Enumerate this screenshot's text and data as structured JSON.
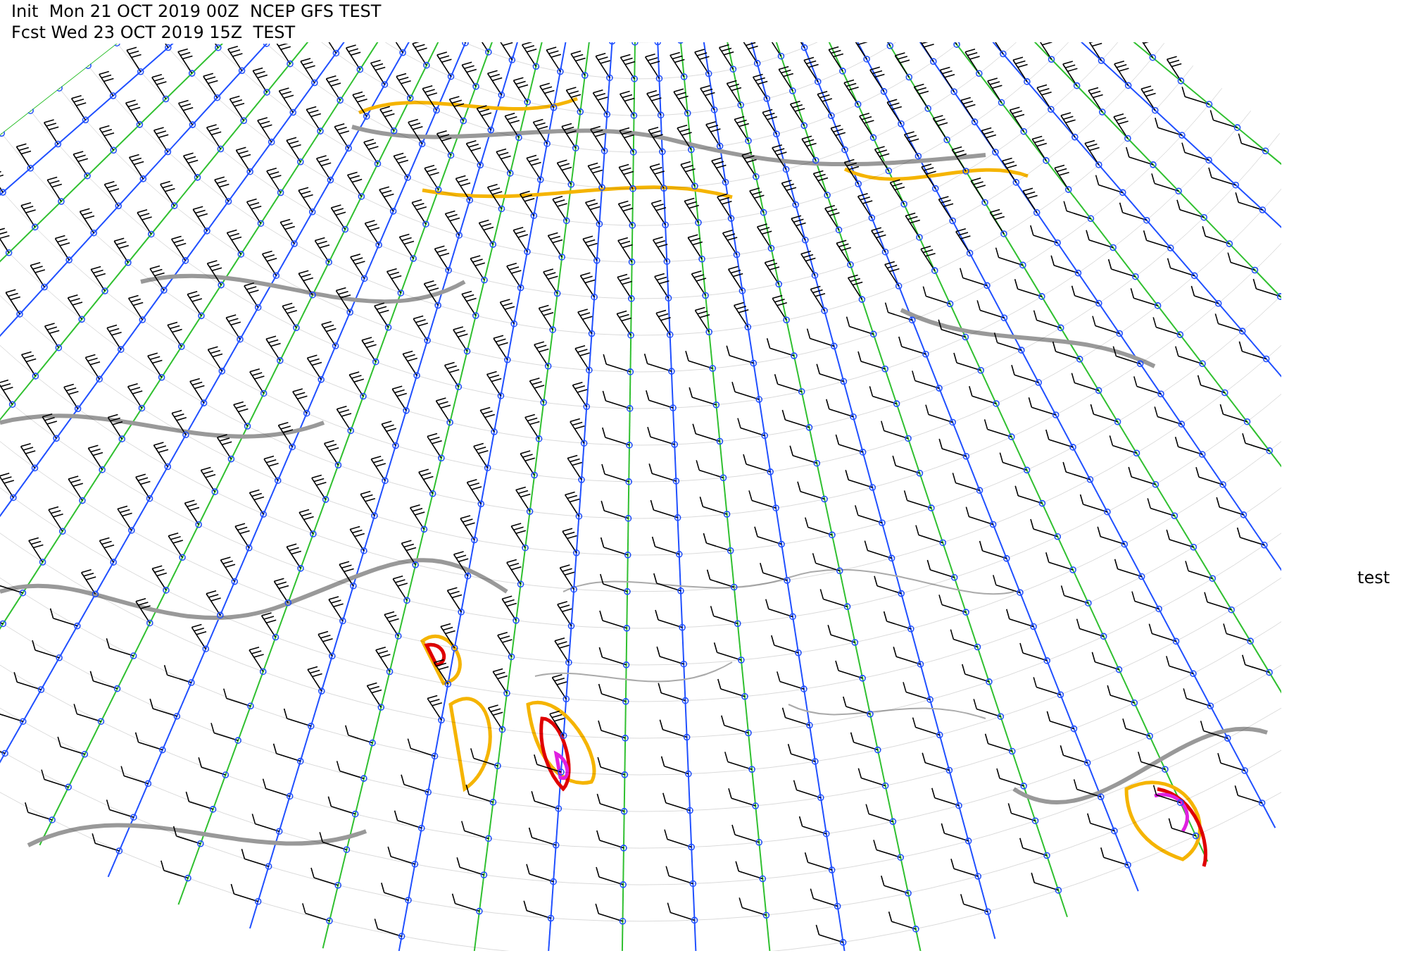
{
  "header": {
    "init_line": "Init  Mon 21 OCT 2019 00Z  NCEP GFS TEST",
    "forecast_line": "Fcst Wed 23 OCT 2019 15Z  TEST"
  },
  "side_label": "test"
}
